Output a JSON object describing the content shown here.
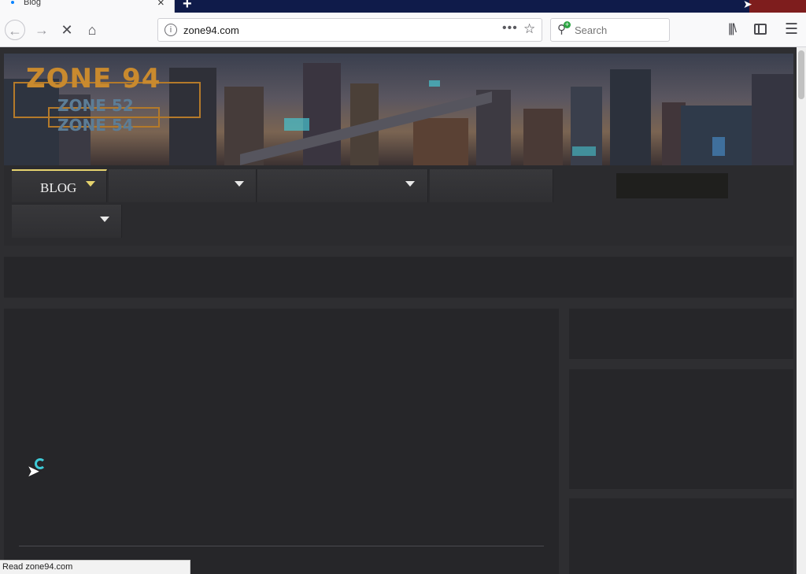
{
  "tab": {
    "title": "Blog"
  },
  "toolbar": {
    "url": "zone94.com",
    "search_placeholder": "Search"
  },
  "site": {
    "logo_main": "ZONE 94",
    "logo_sub1": "ZONE 52",
    "logo_sub2": "ZONE 54",
    "menu": [
      {
        "label": "BLOG"
      }
    ]
  },
  "status": {
    "text": "Read zone94.com"
  },
  "colors": {
    "accent_gold": "#e6d36e",
    "logo_orange": "#c98a2e",
    "page_bg": "#2e2e31",
    "spinner": "#3ec9d6"
  },
  "icons": [
    "back-arrow-icon",
    "forward-arrow-icon",
    "stop-icon",
    "home-icon",
    "info-icon",
    "more-dots-icon",
    "bookmark-star-icon",
    "search-icon",
    "library-icon",
    "sidebar-icon",
    "hamburger-menu-icon",
    "chevron-down-icon",
    "loading-spinner-icon",
    "mouse-cursor-icon"
  ]
}
